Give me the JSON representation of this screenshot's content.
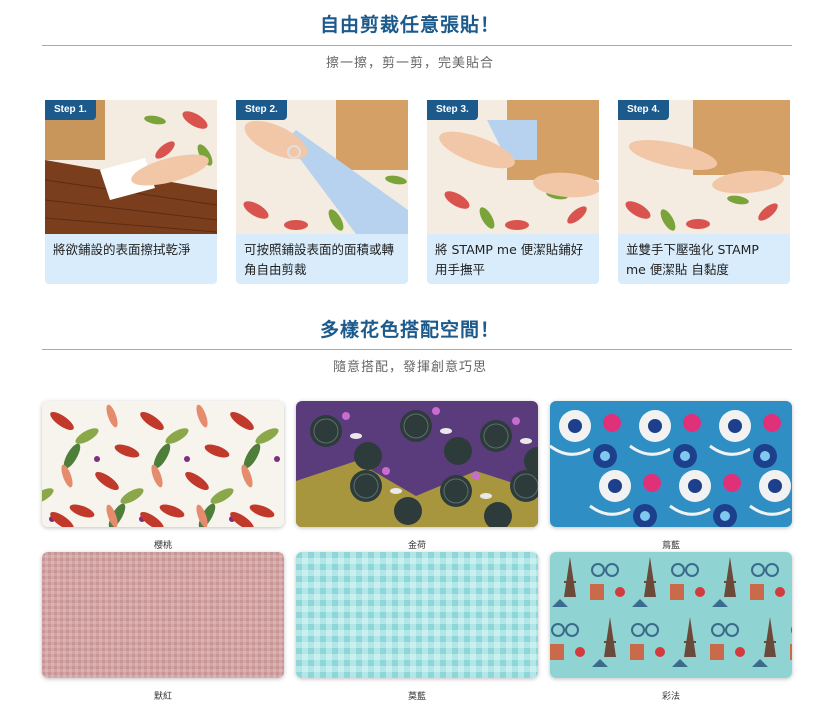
{
  "section1": {
    "title": "自由剪裁任意張貼！",
    "subtitle": "擦一擦，剪一剪，完美貼合"
  },
  "steps": [
    {
      "badge": "Step 1.",
      "text": "將欲鋪設的表面擦拭乾淨",
      "icon": "wiping-photo"
    },
    {
      "badge": "Step 2.",
      "text": "可按照鋪設表面的面積或轉角自由剪裁",
      "icon": "scissors-photo"
    },
    {
      "badge": "Step 3.",
      "text": "將 STAMP me 便潔貼鋪好用手撫平",
      "icon": "smoothing-photo"
    },
    {
      "badge": "Step 4.",
      "text": "並雙手下壓強化 STAMP me 便潔貼 自黏度",
      "icon": "pressing-photo"
    }
  ],
  "section2": {
    "title": "多樣花色搭配空間！",
    "subtitle": "隨意搭配，發揮創意巧思"
  },
  "patterns": [
    {
      "label": "櫻桃",
      "base": "#f7f4ee"
    },
    {
      "label": "金荷",
      "base": "#5a3c7c"
    },
    {
      "label": "蔦藍",
      "base": "#2f8fc4"
    },
    {
      "label": "默紅",
      "base": "#d3a6a6"
    },
    {
      "label": "莫藍",
      "base": "#a6e0e0"
    },
    {
      "label": "彩法",
      "base": "#8fd3d2"
    }
  ],
  "colors": {
    "heading": "#1c5a8c",
    "step_bg": "#d8ecfb",
    "rule": "#8ab3cf"
  }
}
